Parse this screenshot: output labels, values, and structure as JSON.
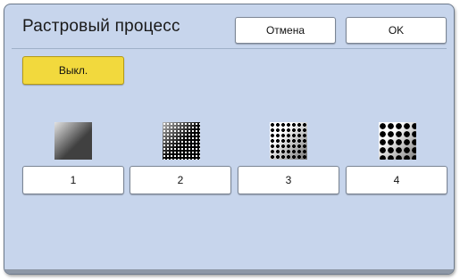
{
  "dialog": {
    "title": "Растровый процесс",
    "cancel_label": "Отмена",
    "ok_label": "OK",
    "off_label": "Выкл."
  },
  "options": [
    {
      "label": "1",
      "icon": "fine-halftone-pattern-icon"
    },
    {
      "label": "2",
      "icon": "medium-fine-halftone-pattern-icon"
    },
    {
      "label": "3",
      "icon": "medium-coarse-halftone-pattern-icon"
    },
    {
      "label": "4",
      "icon": "coarse-halftone-pattern-icon"
    }
  ],
  "colors": {
    "panel_background": "#c7d5ec",
    "off_button": "#f2d93d",
    "button_background": "#ffffff"
  }
}
